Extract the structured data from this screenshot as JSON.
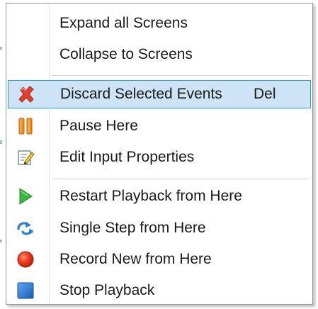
{
  "context_menu": {
    "items": [
      {
        "label": "Expand all Screens",
        "shortcut": "",
        "icon": "none"
      },
      {
        "label": "Collapse to Screens",
        "shortcut": "",
        "icon": "none"
      },
      {
        "label": "Discard Selected Events",
        "shortcut": "Del",
        "icon": "red-x-icon",
        "selected": true
      },
      {
        "label": "Pause Here",
        "shortcut": "",
        "icon": "pause-icon"
      },
      {
        "label": "Edit Input Properties",
        "shortcut": "",
        "icon": "edit-document-icon"
      },
      {
        "label": "Restart Playback from Here",
        "shortcut": "",
        "icon": "play-icon"
      },
      {
        "label": "Single Step from Here",
        "shortcut": "",
        "icon": "step-arrow-icon"
      },
      {
        "label": "Record New from Here",
        "shortcut": "",
        "icon": "record-icon"
      },
      {
        "label": "Stop Playback",
        "shortcut": "",
        "icon": "stop-icon"
      }
    ]
  },
  "colors": {
    "selection_fill": "#cde4f7",
    "selection_border": "#26a0da",
    "discard_red": "#e0412b",
    "pause_orange": "#f08a1c",
    "play_green": "#3cb543",
    "record_red": "#e8341c",
    "stop_blue": "#1e6fd0"
  }
}
